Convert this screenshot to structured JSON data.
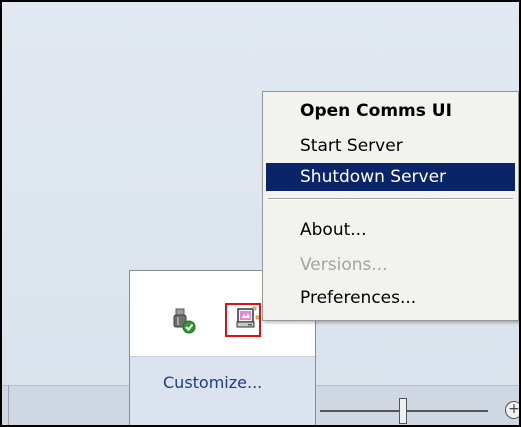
{
  "context_menu": {
    "items": [
      {
        "label": "Open Comms UI",
        "bold": true,
        "disabled": false,
        "selected": false
      },
      {
        "label": "Start Server",
        "bold": false,
        "disabled": false,
        "selected": false
      },
      {
        "label": "Shutdown Server",
        "bold": false,
        "disabled": false,
        "selected": true
      },
      {
        "label": "About...",
        "bold": false,
        "disabled": false,
        "selected": false
      },
      {
        "label": "Versions...",
        "bold": false,
        "disabled": true,
        "selected": false
      },
      {
        "label": "Preferences...",
        "bold": false,
        "disabled": false,
        "selected": false
      }
    ]
  },
  "tray_flyout": {
    "icons": [
      "usb-safely-remove-icon",
      "comms-server-icon"
    ],
    "customize_label": "Customize..."
  },
  "colors": {
    "menu_selection": "#0a246a",
    "highlight_box": "#e01010",
    "customize_link": "#1e3b87"
  }
}
